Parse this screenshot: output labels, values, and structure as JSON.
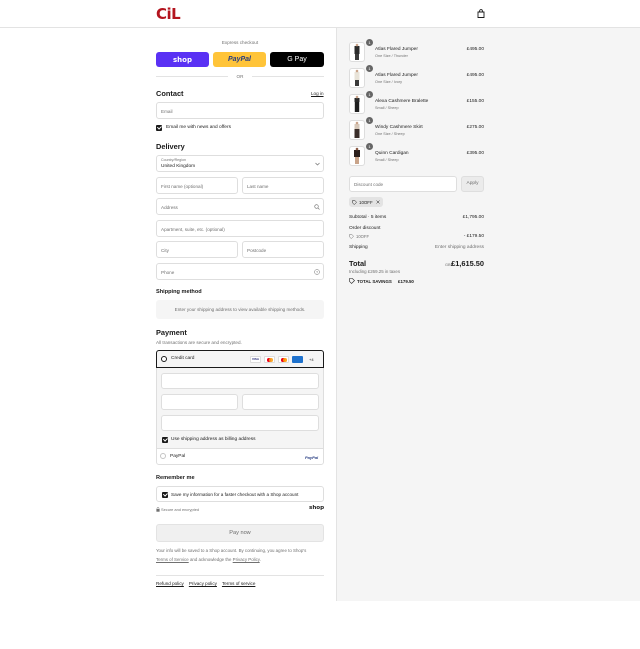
{
  "header": {
    "logo": "CiL",
    "cart_icon": "shopping-bag-icon"
  },
  "express": {
    "title": "Express checkout",
    "shop_label": "shop",
    "paypal_label": "PayPal",
    "gpay_label": "G Pay",
    "or_label": "OR"
  },
  "contact": {
    "title": "Contact",
    "login_label": "Log in",
    "email_placeholder": "Email",
    "newsletter_label": "Email me with news and offers"
  },
  "delivery": {
    "title": "Delivery",
    "country_label": "Country/Region",
    "country_value": "United Kingdom",
    "first_name": "First name (optional)",
    "last_name": "Last name",
    "address": "Address",
    "apartment": "Apartment, suite, etc. (optional)",
    "city": "City",
    "postcode": "Postcode",
    "phone": "Phone"
  },
  "shipping_method": {
    "title": "Shipping method",
    "message": "Enter your shipping address to view available shipping methods."
  },
  "payment": {
    "title": "Payment",
    "subtitle": "All transactions are secure and encrypted.",
    "credit_card_label": "Credit card",
    "more_cards": "+4",
    "billing_label": "Use shipping address as billing address",
    "paypal_label": "PayPal",
    "paypal_logo": "PayPal"
  },
  "remember": {
    "title": "Remember me",
    "save_label": "Save my information for a faster checkout with a Shop account",
    "secure_label": "Secure and encrypted",
    "shop_logo": "shop"
  },
  "pay_button": "Pay now",
  "legal": {
    "text1": "Your info will be saved to a Shop account. By continuing, you agree to Shop's",
    "terms": "Terms of Service",
    "and_text": "and acknowledge the",
    "privacy": "Privacy Policy",
    "period": "."
  },
  "footer_links": [
    "Refund policy",
    "Privacy policy",
    "Terms of service"
  ],
  "order": {
    "items": [
      {
        "qty": "1",
        "name": "Atlas Flared Jumper",
        "variant": "One Size / Thunder",
        "price": "£495.00"
      },
      {
        "qty": "1",
        "name": "Atlas Flared Jumper",
        "variant": "One Size / Ivory",
        "price": "£495.00"
      },
      {
        "qty": "1",
        "name": "Alexa Cashmere Bralette",
        "variant": "Small / Sheep",
        "price": "£155.00"
      },
      {
        "qty": "1",
        "name": "Windy Cashmere Skirt",
        "variant": "One Size / Sheep",
        "price": "£275.00"
      },
      {
        "qty": "1",
        "name": "Quinn Cardigan",
        "variant": "Small / Sheep",
        "price": "£395.00"
      }
    ],
    "discount_placeholder": "Discount code",
    "apply_label": "Apply",
    "applied_code": "10OFF",
    "subtotal_label": "Subtotal · 5 items",
    "subtotal_value": "£1,795.00",
    "order_discount_label": "Order discount",
    "discount_code": "10OFF",
    "discount_value": "- £179.50",
    "shipping_label": "Shipping",
    "shipping_value": "Enter shipping address",
    "total_label": "Total",
    "currency": "GBP",
    "total_value": "£1,615.50",
    "taxes_label": "Including £269.25 in taxes",
    "savings_label": "TOTAL SAVINGS",
    "savings_value": "£179.50"
  }
}
